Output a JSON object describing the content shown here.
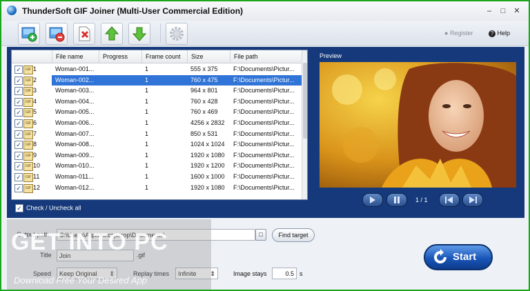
{
  "window": {
    "title": "ThunderSoft GIF Joiner (Multi-User Commercial Edition)"
  },
  "toolbar": {
    "register_label": "Register",
    "help_label": "Help"
  },
  "columns": [
    "File name",
    "Progress",
    "Frame count",
    "Size",
    "File path"
  ],
  "files": [
    {
      "num": "1",
      "name": "Woman-001...",
      "progress": "",
      "frames": "1",
      "size": "555 x 375",
      "path": "F:\\Documents\\Pictur...",
      "checked": true,
      "selected": false
    },
    {
      "num": "2",
      "name": "Woman-002...",
      "progress": "",
      "frames": "1",
      "size": "760 x 475",
      "path": "F:\\Documents\\Pictur...",
      "checked": true,
      "selected": true
    },
    {
      "num": "3",
      "name": "Woman-003...",
      "progress": "",
      "frames": "1",
      "size": "964 x 801",
      "path": "F:\\Documents\\Pictur...",
      "checked": true,
      "selected": false
    },
    {
      "num": "4",
      "name": "Woman-004...",
      "progress": "",
      "frames": "1",
      "size": "760 x 428",
      "path": "F:\\Documents\\Pictur...",
      "checked": true,
      "selected": false
    },
    {
      "num": "5",
      "name": "Woman-005...",
      "progress": "",
      "frames": "1",
      "size": "760 x 469",
      "path": "F:\\Documents\\Pictur...",
      "checked": true,
      "selected": false
    },
    {
      "num": "6",
      "name": "Woman-006...",
      "progress": "",
      "frames": "1",
      "size": "4256 x 2832",
      "path": "F:\\Documents\\Pictur...",
      "checked": true,
      "selected": false
    },
    {
      "num": "7",
      "name": "Woman-007...",
      "progress": "",
      "frames": "1",
      "size": "850 x 531",
      "path": "F:\\Documents\\Pictur...",
      "checked": true,
      "selected": false
    },
    {
      "num": "8",
      "name": "Woman-008...",
      "progress": "",
      "frames": "1",
      "size": "1024 x 1024",
      "path": "F:\\Documents\\Pictur...",
      "checked": true,
      "selected": false
    },
    {
      "num": "9",
      "name": "Woman-009...",
      "progress": "",
      "frames": "1",
      "size": "1920 x 1080",
      "path": "F:\\Documents\\Pictur...",
      "checked": true,
      "selected": false
    },
    {
      "num": "10",
      "name": "Woman-010...",
      "progress": "",
      "frames": "1",
      "size": "1920 x 1200",
      "path": "F:\\Documents\\Pictur...",
      "checked": true,
      "selected": false
    },
    {
      "num": "11",
      "name": "Woman-011...",
      "progress": "",
      "frames": "1",
      "size": "1600 x 1000",
      "path": "F:\\Documents\\Pictur...",
      "checked": true,
      "selected": false
    },
    {
      "num": "12",
      "name": "Woman-012...",
      "progress": "",
      "frames": "1",
      "size": "1920 x 1080",
      "path": "F:\\Documents\\Pictur...",
      "checked": true,
      "selected": false
    }
  ],
  "check_all_label": "Check / Uncheck all",
  "preview": {
    "label": "Preview",
    "page": "1 / 1"
  },
  "output": {
    "path_label": "Output path",
    "path_value": "C:\\Users\\Администратор\\Documents\\",
    "find_target_label": "Find target",
    "title_label": "Title",
    "title_value": "Join",
    "ext": ".gif",
    "speed_label": "Speed",
    "speed_value": "Keep Original",
    "replay_label": "Replay times",
    "replay_value": "Infinite",
    "stays_label": "Image stays",
    "stays_value": "0.5",
    "stays_unit": "s"
  },
  "start_label": "Start",
  "watermark": {
    "title": "GET INTO PC",
    "subtitle": "Download Free Your Desired App"
  },
  "colors": {
    "accent": "#15397a",
    "selection": "#2f74d6",
    "frame": "#1aa51a"
  }
}
